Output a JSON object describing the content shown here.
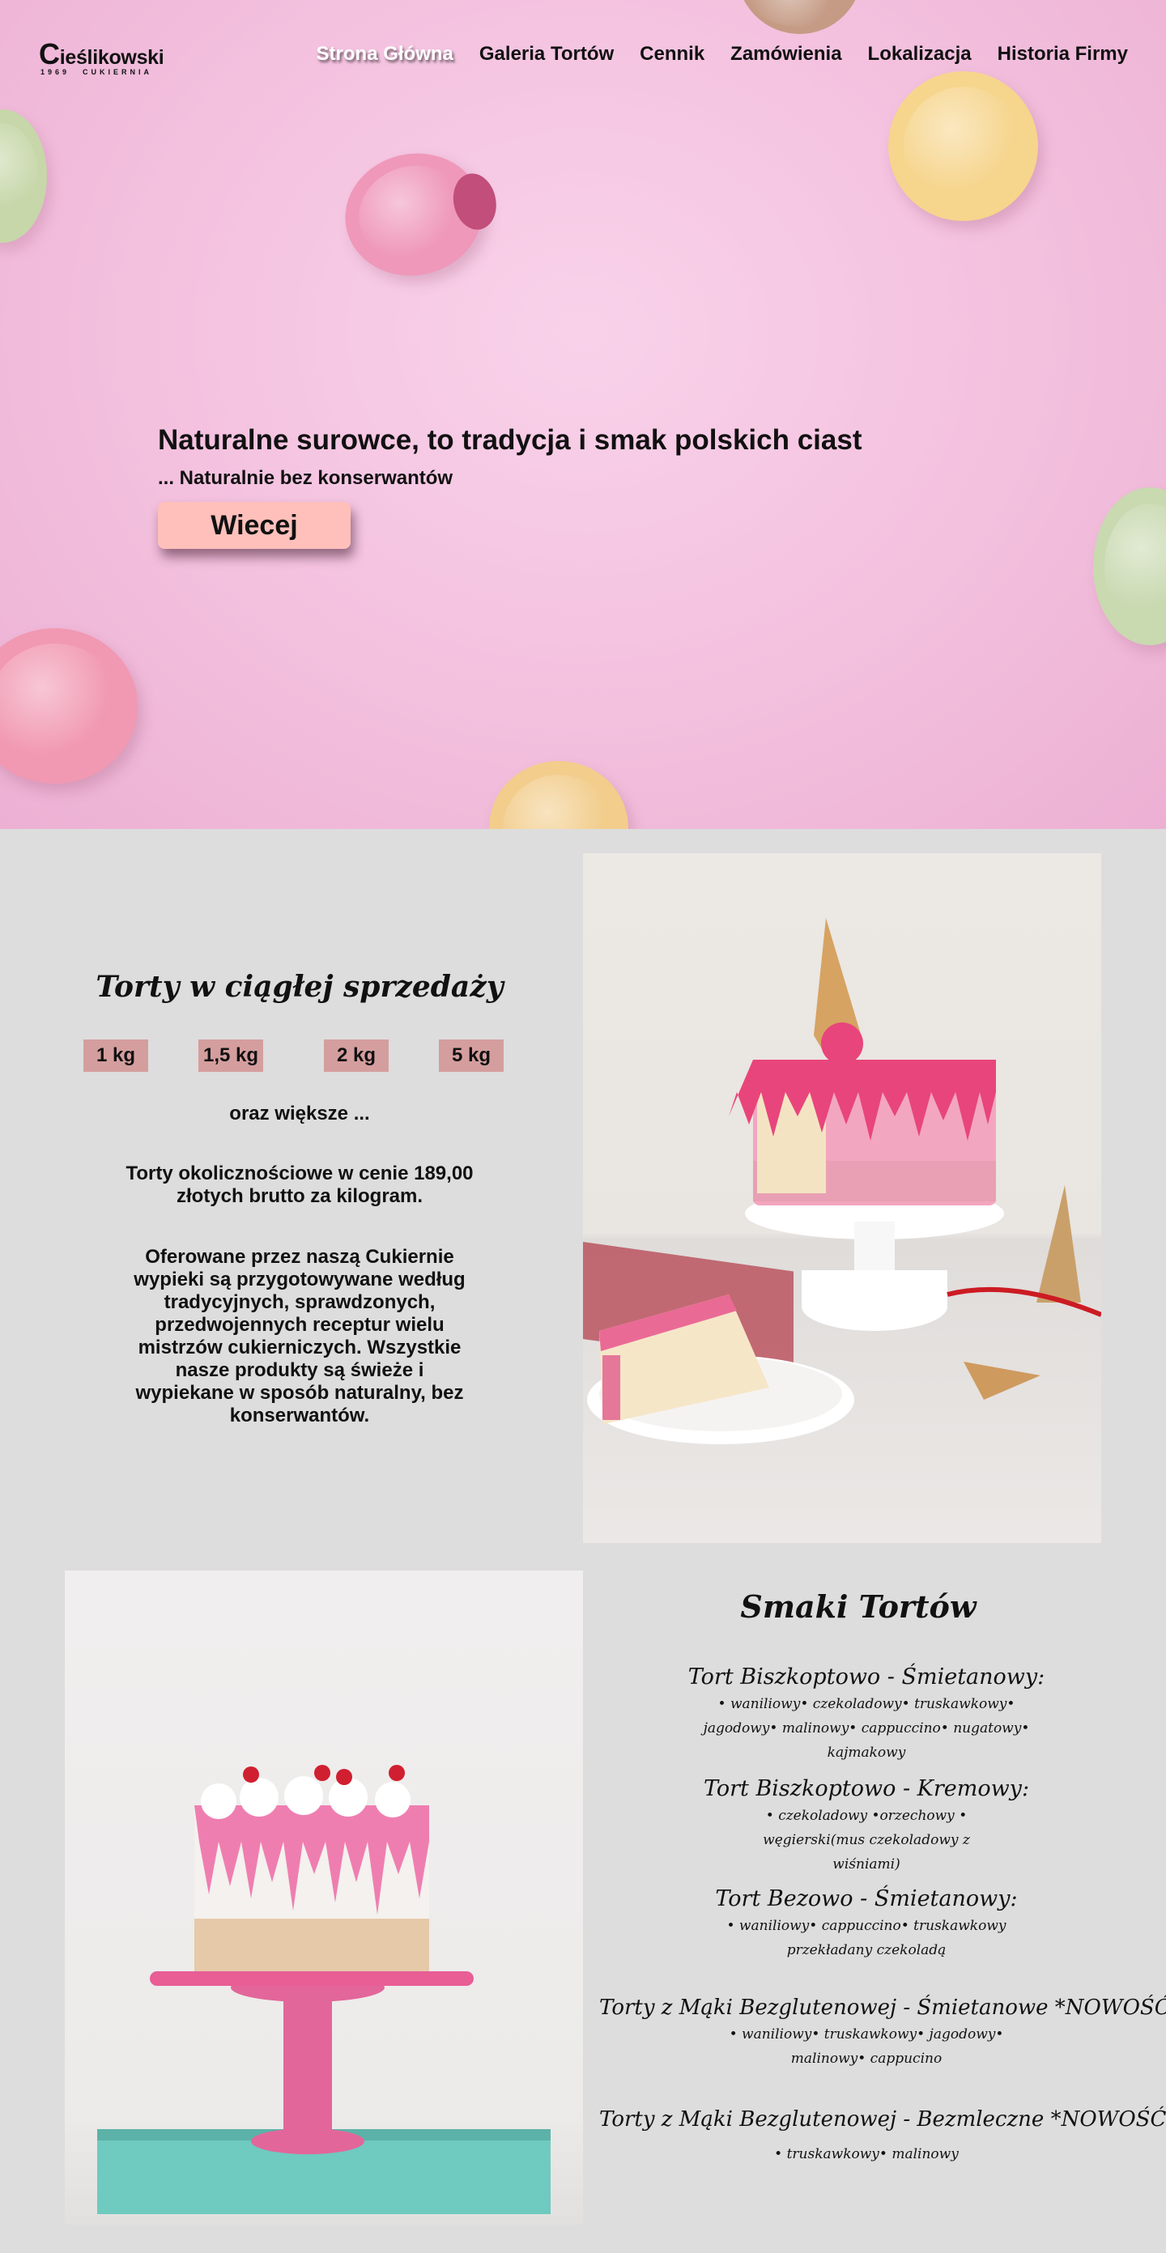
{
  "logo": {
    "first_letter": "C",
    "rest": "ieślikowski",
    "year": "1969",
    "subtitle": "CUKIERNIA"
  },
  "nav": [
    "Strona Główna",
    "Galeria Tortów",
    "Cennik",
    "Zamówienia",
    "Lokalizacja",
    "Historia Firmy"
  ],
  "hero": {
    "title": "Naturalne surowce, to tradycja i smak polskich ciast",
    "subtitle": "... Naturalnie bez konserwantów",
    "button": "Wiecej"
  },
  "offer": {
    "title": "Torty w ciągłej sprzedaży",
    "sizes": [
      "1 kg",
      "1,5 kg",
      "2 kg",
      "5 kg"
    ],
    "more": "oraz większe ...",
    "price": "Torty okolicznościowe w cenie 189,00 złotych brutto za kilogram.",
    "description": "Oferowane przez naszą Cukiernie wypieki są przygotowywane według tradycyjnych, sprawdzonych, przedwojennych receptur wielu mistrzów cukierniczych. Wszystkie nasze produkty są świeże i wypiekane w sposób naturalny, bez konserwantów."
  },
  "flavors": {
    "title": "Smaki Tortów",
    "items": [
      {
        "name": "Tort Biszkoptowo - Śmietanowy:",
        "list": "• waniliowy• czekoladowy• truskawkowy• jagodowy• malinowy• cappuccino• nugatowy• kajmakowy"
      },
      {
        "name": "Tort Biszkoptowo - Kremowy:",
        "list": "• czekoladowy •orzechowy • węgierski(mus czekoladowy z wiśniami)"
      },
      {
        "name": "Tort Bezowo - Śmietanowy:",
        "list": "• waniliowy• cappuccino• truskawkowy przekładany czekoladą"
      },
      {
        "name": "Torty z Mąki Bezglutenowej - Śmietanowe *NOWOŚĆ",
        "list": "• waniliowy• truskawkowy• jagodowy• malinowy• cappucino"
      },
      {
        "name": "Torty z Mąki Bezglutenowej - Bezmleczne *NOWOŚĆ",
        "list": "• truskawkowy• malinowy"
      }
    ]
  },
  "colors": {
    "hero_pink": "#f3c0de",
    "button": "#ffc0bb",
    "size_badge": "#d59e9e",
    "background": "#dddddd"
  }
}
